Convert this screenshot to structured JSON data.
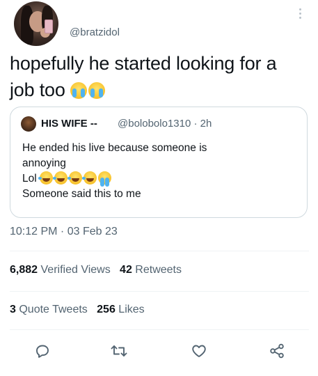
{
  "tweet": {
    "handle": "@bratzidol",
    "text_line1": "hopefully he started looking for a",
    "text_line2": "job too",
    "emojis_after_text": [
      "loudly-crying-face",
      "loudly-crying-face"
    ]
  },
  "quote": {
    "name": "HIS WIFE --",
    "handle_time": "@bolobolo1310 · 2h",
    "line1": "He ended his live because someone is",
    "line2": "annoying",
    "line3": "Lol",
    "line3_emojis": [
      "rolling-on-floor-laughing",
      "rolling-on-floor-laughing",
      "rolling-on-floor-laughing",
      "rolling-on-floor-laughing",
      "loudly-crying-face"
    ],
    "line4": "Someone said this to me"
  },
  "timestamp": "10:12 PM · 03 Feb 23",
  "stats": {
    "views_count": "6,882",
    "views_label": "Verified Views",
    "retweets_count": "42",
    "retweets_label": "Retweets",
    "quotes_count": "3",
    "quotes_label": "Quote Tweets",
    "likes_count": "256",
    "likes_label": "Likes"
  },
  "actions": [
    "reply-icon",
    "retweet-icon",
    "like-icon",
    "share-icon"
  ],
  "colors": {
    "text": "#0f1419",
    "secondary": "#536471",
    "border": "#cfd9de",
    "divider": "#eff3f4"
  }
}
